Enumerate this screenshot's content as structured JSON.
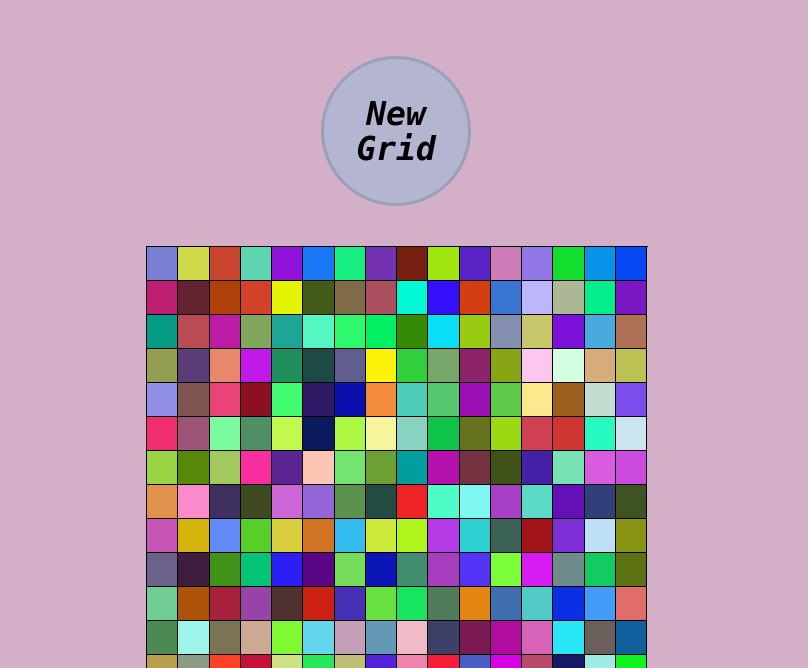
{
  "button": {
    "label": "New Grid"
  },
  "grid": {
    "columns": 16,
    "colors": [
      [
        "#7a7fd5",
        "#cfd94a",
        "#c84530",
        "#5fd6b2",
        "#9113db",
        "#1877f4",
        "#19ee82",
        "#7232b2",
        "#782010",
        "#a1e60e",
        "#5822c4",
        "#cd7cb8",
        "#9177e6",
        "#13de2e",
        "#0794e8",
        "#0447f3"
      ],
      [
        "#bd1e72",
        "#632331",
        "#b0410a",
        "#d3412a",
        "#e4f204",
        "#435c19",
        "#7f6b46",
        "#aa4f5e",
        "#03f8d6",
        "#3510fb",
        "#d43e12",
        "#3a75d1",
        "#bcb7fc",
        "#acb795",
        "#03ef8b",
        "#7a17c3"
      ],
      [
        "#069b85",
        "#bb4b52",
        "#bb1ca6",
        "#80a75c",
        "#1fa595",
        "#54f7c1",
        "#2ef96e",
        "#04f064",
        "#338b05",
        "#07dff6",
        "#98cb12",
        "#8590b1",
        "#c8c76c",
        "#7c11d9",
        "#49abdd",
        "#ae6f55"
      ],
      [
        "#939e50",
        "#5b3d7a",
        "#e9876c",
        "#c119ea",
        "#208f5e",
        "#1b4a47",
        "#5f5e8f",
        "#f9f307",
        "#2fd039",
        "#76a769",
        "#8b2468",
        "#88a313",
        "#fbc7ee",
        "#d4ffe1",
        "#d8ab7b",
        "#bbc253"
      ],
      [
        "#8f8fe8",
        "#7e564f",
        "#ea4379",
        "#8c0f22",
        "#3ffc71",
        "#2e1966",
        "#0b0fae",
        "#f48a3b",
        "#4ccbb6",
        "#55c96f",
        "#9c0fb4",
        "#5cca48",
        "#fde98d",
        "#9c5e1e",
        "#c3ddd0",
        "#7b4deb"
      ],
      [
        "#f12f70",
        "#9c5577",
        "#7dfb9f",
        "#4f8f63",
        "#c1fa4c",
        "#0b1a5e",
        "#acf742",
        "#f7f59b",
        "#87d2c0",
        "#10c44b",
        "#67721f",
        "#9bd912",
        "#d04154",
        "#cf3530",
        "#26f9c2",
        "#cbe4ef"
      ],
      [
        "#99d445",
        "#56880a",
        "#a1c95e",
        "#f92ea1",
        "#5b2493",
        "#fdc6b4",
        "#73e46f",
        "#6da034",
        "#019d9f",
        "#b512ad",
        "#733341",
        "#3f5217",
        "#4521a9",
        "#78e2b7",
        "#d95cde",
        "#cc4bdf"
      ],
      [
        "#e0924d",
        "#fb8acd",
        "#3f3062",
        "#3d4a22",
        "#cc66d6",
        "#9465d7",
        "#5b924d",
        "#234b43",
        "#ee2326",
        "#4ffcc8",
        "#7ef8f1",
        "#a840c5",
        "#5bdac5",
        "#6311b6",
        "#323f78",
        "#3f5322"
      ],
      [
        "#c755b6",
        "#d3b30c",
        "#628af9",
        "#58ce28",
        "#d9ce3e",
        "#d17524",
        "#34bbef",
        "#cbea3b",
        "#aff41b",
        "#b43be4",
        "#2dcfd3",
        "#3c6258",
        "#a11417",
        "#7d2ed7",
        "#bde0f4",
        "#899414"
      ],
      [
        "#6c6188",
        "#3f1d3f",
        "#3e9217",
        "#03c376",
        "#2b1ff3",
        "#5a0687",
        "#74de5b",
        "#0c15b6",
        "#428c70",
        "#a73dbf",
        "#5432f6",
        "#7cff3a",
        "#d81bf2",
        "#6f8c8a",
        "#13cc61",
        "#5c7212"
      ],
      [
        "#6fcc95",
        "#ad5207",
        "#a6223a",
        "#9743a8",
        "#4f3230",
        "#cb2112",
        "#4530b6",
        "#67e040",
        "#17e560",
        "#4f7b5a",
        "#e58513",
        "#3f6eaf",
        "#52cac6",
        "#0b2fe2",
        "#419df7",
        "#e06d68"
      ],
      [
        "#4c8955",
        "#9df4ea",
        "#7b7454",
        "#cca992",
        "#7ef934",
        "#61d6ed",
        "#c6a0b8",
        "#6399b6",
        "#f2b9c6",
        "#3d4167",
        "#7a1a50",
        "#b10c9f",
        "#d763b7",
        "#28e8f7",
        "#6b5f5c",
        "#11609e"
      ],
      [
        "#baa04b",
        "#8b9b85",
        "#fe4126",
        "#c6113d",
        "#cde187",
        "#25e757",
        "#bcbf75",
        "#5422d8",
        "#ec84ae",
        "#f61d3c",
        "#4a5dc0",
        "#d603e3",
        "#b74a6a",
        "#161a63",
        "#9eece3",
        "#0ff41f"
      ]
    ]
  }
}
